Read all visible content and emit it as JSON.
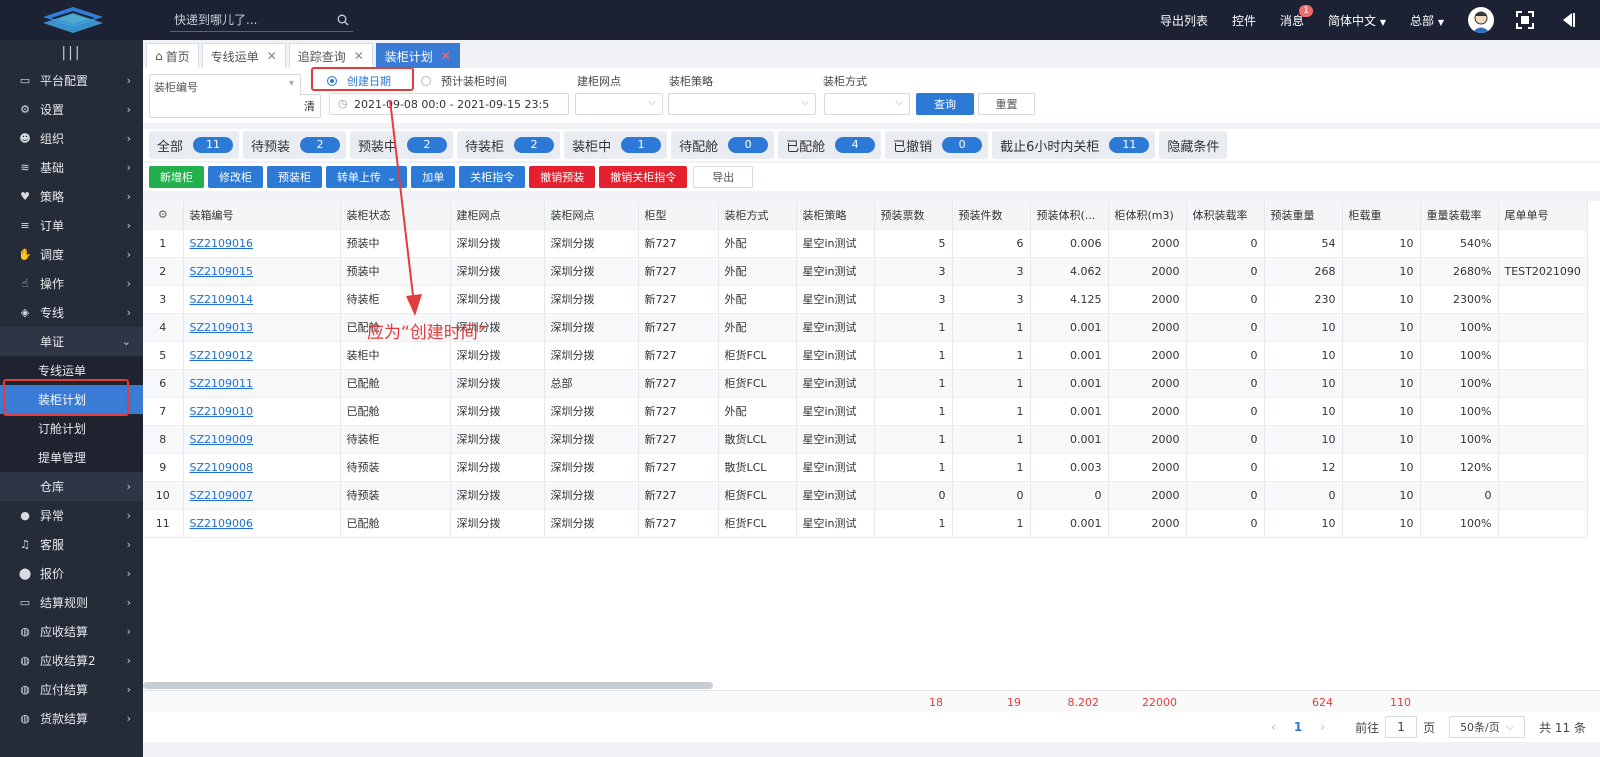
{
  "topbar": {
    "search_placeholder": "快递到哪儿了...",
    "export_list": "导出列表",
    "plugin": "控件",
    "messages": "消息",
    "message_count": "1",
    "language": "简体中文",
    "org": "总部"
  },
  "sidebar": {
    "items": [
      {
        "label": "平台配置",
        "icon": "monitor-icon"
      },
      {
        "label": "设置",
        "icon": "gear-icon"
      },
      {
        "label": "组织",
        "icon": "users-icon"
      },
      {
        "label": "基础",
        "icon": "layers-icon"
      },
      {
        "label": "策略",
        "icon": "heart-icon"
      },
      {
        "label": "订单",
        "icon": "list-icon"
      },
      {
        "label": "调度",
        "icon": "hand-icon"
      },
      {
        "label": "操作",
        "icon": "pointer-icon"
      },
      {
        "label": "专线",
        "icon": "shield-icon"
      }
    ],
    "open_group": "单证",
    "sub_items": [
      "专线运单",
      "装柜计划",
      "订舱计划",
      "提单管理"
    ],
    "items_after": [
      {
        "label": "仓库",
        "icon": "",
        "open": true
      },
      {
        "label": "异常",
        "icon": "alert-icon"
      },
      {
        "label": "客服",
        "icon": "headset-icon"
      },
      {
        "label": "报价",
        "icon": "pin-icon"
      },
      {
        "label": "结算规则",
        "icon": "monitor-icon"
      },
      {
        "label": "应收结算",
        "icon": "coins-icon"
      },
      {
        "label": "应收结算2",
        "icon": "coins-icon"
      },
      {
        "label": "应付结算",
        "icon": "coins-icon"
      },
      {
        "label": "货款结算",
        "icon": "coins-icon"
      }
    ]
  },
  "tabs": [
    {
      "label": "首页",
      "closable": false
    },
    {
      "label": "专线运单",
      "closable": true
    },
    {
      "label": "追踪查询",
      "closable": true
    },
    {
      "label": "装柜计划",
      "closable": true,
      "active": true
    }
  ],
  "filters": {
    "container_no_placeholder": "装柜编号",
    "clear": "清",
    "radio_created": "创建日期",
    "radio_planned": "预计装柜时间",
    "date_range": "2021-09-08 00:0 - 2021-09-15 23:5",
    "label_site": "建柜网点",
    "label_strategy": "装柜策略",
    "label_mode": "装柜方式",
    "query": "查询",
    "reset": "重置"
  },
  "chips": [
    {
      "label": "全部",
      "count": "11"
    },
    {
      "label": "待预装",
      "count": "2"
    },
    {
      "label": "预装中",
      "count": "2"
    },
    {
      "label": "待装柜",
      "count": "2"
    },
    {
      "label": "装柜中",
      "count": "1"
    },
    {
      "label": "待配舱",
      "count": "0"
    },
    {
      "label": "已配舱",
      "count": "4"
    },
    {
      "label": "已撤销",
      "count": "0"
    },
    {
      "label": "截止6小时内关柜",
      "count": "11"
    }
  ],
  "hide_conditions": "隐藏条件",
  "actions": [
    {
      "label": "新增柜",
      "style": "green"
    },
    {
      "label": "修改柜",
      "style": "blue"
    },
    {
      "label": "预装柜",
      "style": "blue"
    },
    {
      "label": "转单上传",
      "style": "blue",
      "dropdown": true
    },
    {
      "label": "加单",
      "style": "blue"
    },
    {
      "label": "关柜指令",
      "style": "blue"
    },
    {
      "label": "撤销预装",
      "style": "red"
    },
    {
      "label": "撤销关柜指令",
      "style": "red"
    },
    {
      "label": "导出",
      "style": "white"
    }
  ],
  "table": {
    "columns": [
      "装箱编号",
      "装柜状态",
      "建柜网点",
      "装柜网点",
      "柜型",
      "装柜方式",
      "装柜策略",
      "预装票数",
      "预装件数",
      "预装体积(...",
      "柜体积(m3)",
      "体积装载率",
      "预装重量",
      "柜载重",
      "重量装载率",
      "尾单单号"
    ],
    "rows": [
      [
        "1",
        "SZ2109016",
        "预装中",
        "深圳分拨",
        "深圳分拨",
        "新727",
        "外配",
        "星空in测试",
        "5",
        "6",
        "0.006",
        "2000",
        "0",
        "54",
        "10",
        "540%",
        ""
      ],
      [
        "2",
        "SZ2109015",
        "预装中",
        "深圳分拨",
        "深圳分拨",
        "新727",
        "外配",
        "星空in测试",
        "3",
        "3",
        "4.062",
        "2000",
        "0",
        "268",
        "10",
        "2680%",
        "TEST2021090"
      ],
      [
        "3",
        "SZ2109014",
        "待装柜",
        "深圳分拨",
        "深圳分拨",
        "新727",
        "外配",
        "星空in测试",
        "3",
        "3",
        "4.125",
        "2000",
        "0",
        "230",
        "10",
        "2300%",
        ""
      ],
      [
        "4",
        "SZ2109013",
        "已配舱",
        "深圳分拨",
        "深圳分拨",
        "新727",
        "外配",
        "星空in测试",
        "1",
        "1",
        "0.001",
        "2000",
        "0",
        "10",
        "10",
        "100%",
        ""
      ],
      [
        "5",
        "SZ2109012",
        "装柜中",
        "深圳分拨",
        "深圳分拨",
        "新727",
        "柜货FCL",
        "星空in测试",
        "1",
        "1",
        "0.001",
        "2000",
        "0",
        "10",
        "10",
        "100%",
        ""
      ],
      [
        "6",
        "SZ2109011",
        "已配舱",
        "深圳分拨",
        "总部",
        "新727",
        "柜货FCL",
        "星空in测试",
        "1",
        "1",
        "0.001",
        "2000",
        "0",
        "10",
        "10",
        "100%",
        ""
      ],
      [
        "7",
        "SZ2109010",
        "已配舱",
        "深圳分拨",
        "深圳分拨",
        "新727",
        "外配",
        "星空in测试",
        "1",
        "1",
        "0.001",
        "2000",
        "0",
        "10",
        "10",
        "100%",
        ""
      ],
      [
        "8",
        "SZ2109009",
        "待装柜",
        "深圳分拨",
        "深圳分拨",
        "新727",
        "散货LCL",
        "星空in测试",
        "1",
        "1",
        "0.001",
        "2000",
        "0",
        "10",
        "10",
        "100%",
        ""
      ],
      [
        "9",
        "SZ2109008",
        "待预装",
        "深圳分拨",
        "深圳分拨",
        "新727",
        "散货LCL",
        "星空in测试",
        "1",
        "1",
        "0.003",
        "2000",
        "0",
        "12",
        "10",
        "120%",
        ""
      ],
      [
        "10",
        "SZ2109007",
        "待预装",
        "深圳分拨",
        "深圳分拨",
        "新727",
        "柜货FCL",
        "星空in测试",
        "0",
        "0",
        "0",
        "2000",
        "0",
        "0",
        "10",
        "0",
        ""
      ],
      [
        "11",
        "SZ2109006",
        "已配舱",
        "深圳分拨",
        "深圳分拨",
        "新727",
        "柜货FCL",
        "星空in测试",
        "1",
        "1",
        "0.001",
        "2000",
        "0",
        "10",
        "10",
        "100%",
        ""
      ]
    ],
    "totals": {
      "tickets": "18",
      "pieces": "19",
      "volume": "8.202",
      "cabinet_volume": "22000",
      "weight": "624",
      "load": "110"
    }
  },
  "pager": {
    "current": "1",
    "goto_prefix": "前往",
    "goto_value": "1",
    "goto_suffix": "页",
    "page_size": "50条/页",
    "total": "共 11 条"
  },
  "annotation": {
    "text": "应为“创建时间”",
    "color": "#e23c3c"
  }
}
